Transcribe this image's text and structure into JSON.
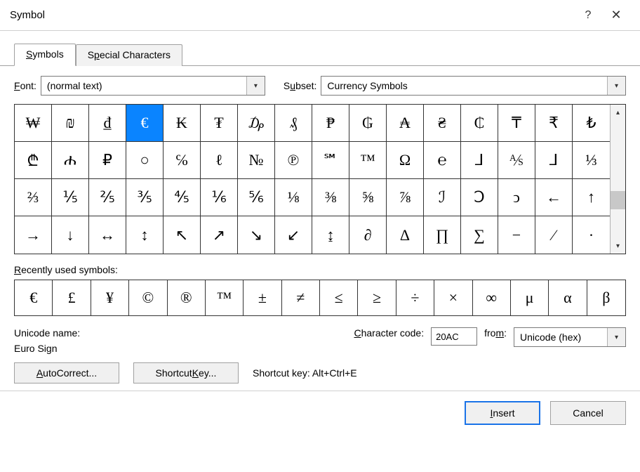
{
  "title": "Symbol",
  "tabs": {
    "symbols": "Symbols",
    "special": "Special Characters"
  },
  "fontLabel": "Font:",
  "fontValue": "(normal text)",
  "subsetLabel": "Subset:",
  "subsetValue": "Currency Symbols",
  "selectedIndex": 3,
  "grid": [
    "₩",
    "₪",
    "₫",
    "€",
    "₭",
    "₮",
    "₯",
    "₰",
    "₱",
    "₲",
    "₳",
    "₴",
    "₵",
    "₸",
    "₹",
    "₺",
    "₾",
    "ሐ",
    "₽",
    "○",
    "℅",
    "ℓ",
    "№",
    "℗",
    "℠",
    "™",
    "Ω",
    "℮",
    "⅃",
    "⅍",
    "⅃",
    "⅓",
    "⅔",
    "⅕",
    "⅖",
    "⅗",
    "⅘",
    "⅙",
    "⅚",
    "⅛",
    "⅜",
    "⅝",
    "⅞",
    "ℐ",
    "Ↄ",
    "ↄ",
    "←",
    "↑",
    "→",
    "↓",
    "↔",
    "↕",
    "↖",
    "↗",
    "↘",
    "↙",
    "↨",
    "∂",
    "∆",
    "∏",
    "∑",
    "−",
    "∕",
    "∙"
  ],
  "recentLabel": "Recently used symbols:",
  "recent": [
    "€",
    "£",
    "¥",
    "©",
    "®",
    "™",
    "±",
    "≠",
    "≤",
    "≥",
    "÷",
    "×",
    "∞",
    "μ",
    "α",
    "β"
  ],
  "unicodeNameLabel": "Unicode name:",
  "unicodeName": "Euro Sign",
  "charCodeLabel": "Character code:",
  "charCode": "20AC",
  "fromLabel": "from:",
  "fromValue": "Unicode (hex)",
  "autoCorrect": "AutoCorrect...",
  "shortcutKeyBtn": "Shortcut Key...",
  "shortcutKeyLabel": "Shortcut key: ",
  "shortcutKeyValue": "Alt+Ctrl+E",
  "insert": "Insert",
  "cancel": "Cancel"
}
